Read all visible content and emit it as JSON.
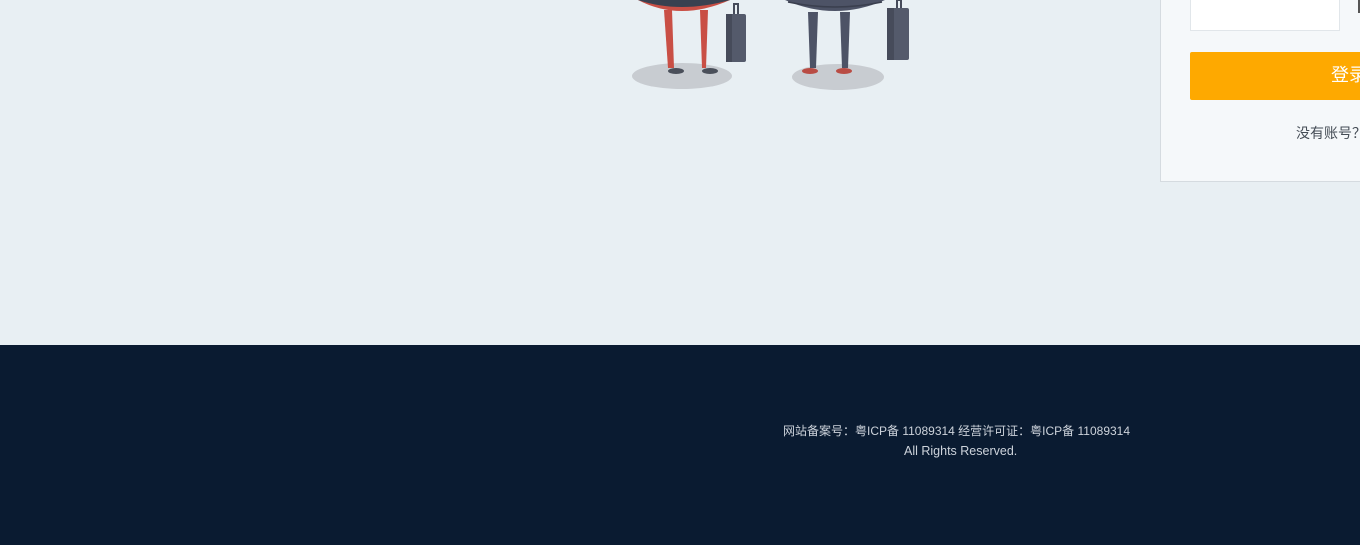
{
  "login": {
    "button_label": "登录",
    "register_prompt": "没有账号？"
  },
  "footer": {
    "icp_line": "网站备案号：粤ICP备 11089314 经营许可证：粤ICP备 11089314",
    "rights_line": "All Rights Reserved."
  },
  "colors": {
    "page_bg": "#e8eff3",
    "footer_bg": "#0a1b31",
    "accent": "#fea900"
  },
  "icons": [
    "travelers-illustration"
  ]
}
